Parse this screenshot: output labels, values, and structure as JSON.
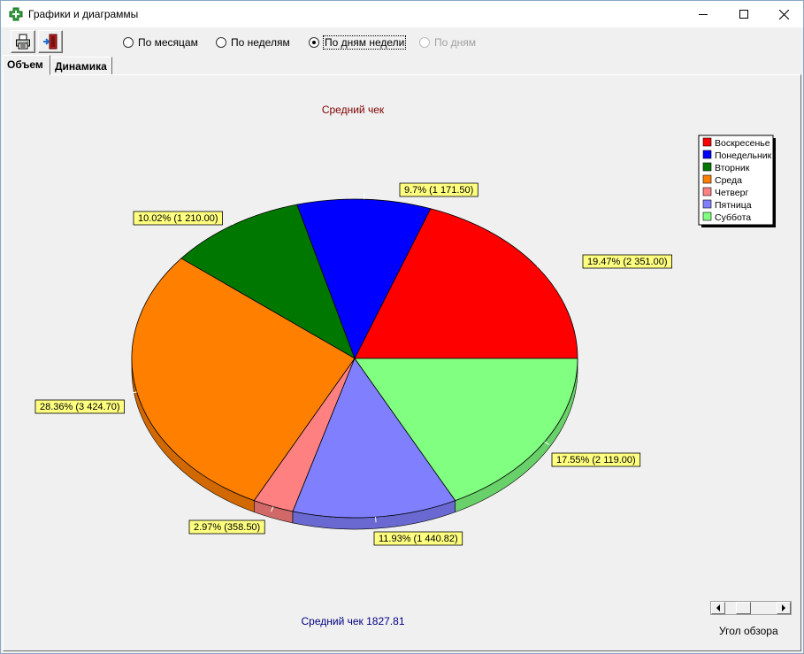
{
  "window": {
    "title": "Графики и диаграммы",
    "icon": "green-cross-icon"
  },
  "toolbar": {
    "print_icon": "printer-icon",
    "exit_icon": "exit-door-icon",
    "radios": [
      {
        "label": "По месяцам",
        "checked": false,
        "disabled": false
      },
      {
        "label": "По неделям",
        "checked": false,
        "disabled": false
      },
      {
        "label": "По дням недели",
        "checked": true,
        "disabled": false
      },
      {
        "label": "По дням",
        "checked": false,
        "disabled": true
      }
    ]
  },
  "tabs": [
    {
      "label": "Объем",
      "active": true
    },
    {
      "label": "Динамика",
      "active": false
    }
  ],
  "chart_data": {
    "type": "pie",
    "title": "Средний чек",
    "footer": "Средний чек 1827.81",
    "legend_position": "top-right",
    "slices": [
      {
        "name": "Воскресенье",
        "value": 2351.0,
        "label": "19.47%  (2 351.00)",
        "color": "#ff0000"
      },
      {
        "name": "Понедельник",
        "value": 1171.5,
        "label": "9.7%  (1 171.50)",
        "color": "#0000ff"
      },
      {
        "name": "Вторник",
        "value": 1210.0,
        "label": "10.02%  (1 210.00)",
        "color": "#007800"
      },
      {
        "name": "Среда",
        "value": 3424.7,
        "label": "28.36%  (3 424.70)",
        "color": "#ff8000"
      },
      {
        "name": "Четверг",
        "value": 358.5,
        "label": "2.97%  (358.50)",
        "color": "#ff8080"
      },
      {
        "name": "Пятница",
        "value": 1440.82,
        "label": "11.93%  (1 440.82)",
        "color": "#8080ff"
      },
      {
        "name": "Суббота",
        "value": 2119.0,
        "label": "17.55%  (2 119.00)",
        "color": "#80ff80"
      }
    ]
  },
  "view_angle": {
    "label": "Угол обзора",
    "value": 0.3
  },
  "colors": {
    "title_text": "#800000",
    "footer_text": "#000080",
    "label_bg": "#ffff80"
  }
}
